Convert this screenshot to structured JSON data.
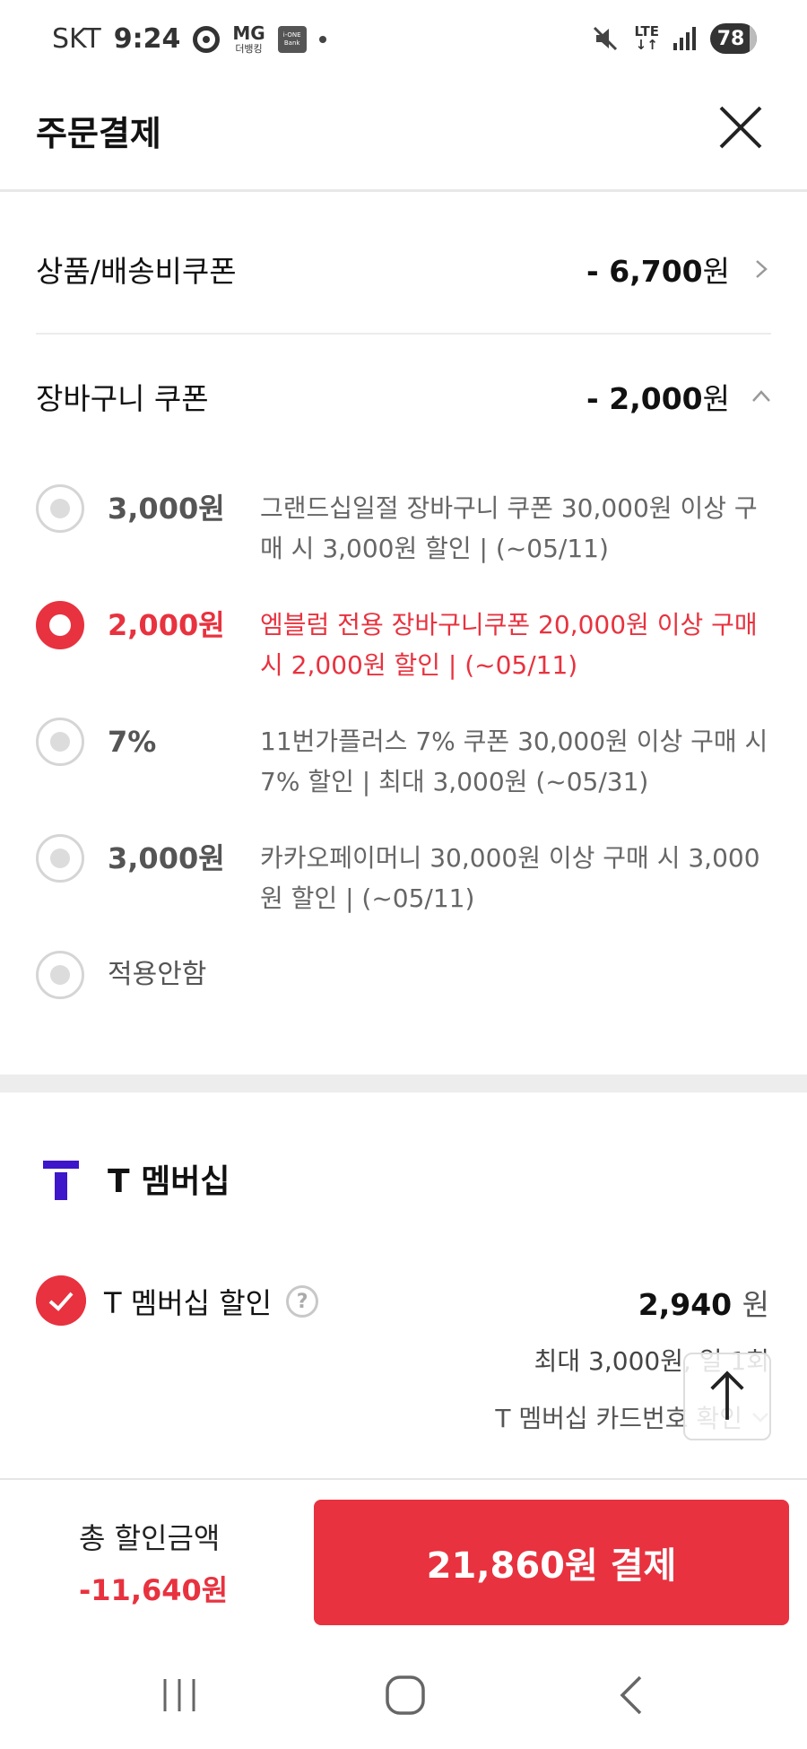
{
  "status_bar": {
    "carrier": "SKT",
    "time": "9:24",
    "mg_top": "MG",
    "mg_bottom": "더뱅킹",
    "bank_line1": "i-ONE",
    "bank_line2": "Bank",
    "network_top": "LTE",
    "battery": "78"
  },
  "header": {
    "title": "주문결제"
  },
  "product_coupon": {
    "label": "상품/배송비쿠폰",
    "amount": "- 6,700",
    "unit": "원"
  },
  "cart_coupon": {
    "label": "장바구니 쿠폰",
    "amount": "- 2,000",
    "unit": "원",
    "options": [
      {
        "amount": "3,000원",
        "desc": "그랜드십일절 장바구니 쿠폰 30,000원 이상 구매 시 3,000원 할인 | (~05/11)",
        "selected": false
      },
      {
        "amount": "2,000원",
        "desc": "엠블럼 전용 장바구니쿠폰 20,000원 이상 구매 시 2,000원 할인 | (~05/11)",
        "selected": true
      },
      {
        "amount": "7%",
        "desc": "11번가플러스 7% 쿠폰 30,000원 이상 구매 시 7% 할인 | 최대 3,000원 (~05/31)",
        "selected": false
      },
      {
        "amount": "3,000원",
        "desc": "카카오페이머니 30,000원 이상 구매 시 3,000원 할인 | (~05/11)",
        "selected": false
      }
    ],
    "no_apply_label": "적용안함"
  },
  "t_membership": {
    "title": "T 멤버십",
    "discount_label": "T 멤버십 할인",
    "help": "?",
    "amount": "2,940",
    "unit": "원",
    "limit_text": "최대 3,000원, 일 1회",
    "card_text": "T 멤버십 카드번호 확인"
  },
  "footer": {
    "total_label": "총 할인금액",
    "total_value": "-11,640원",
    "pay_button": "21,860원 결제"
  },
  "colors": {
    "accent": "#e8323f",
    "t_logo": "#3d17c9"
  }
}
